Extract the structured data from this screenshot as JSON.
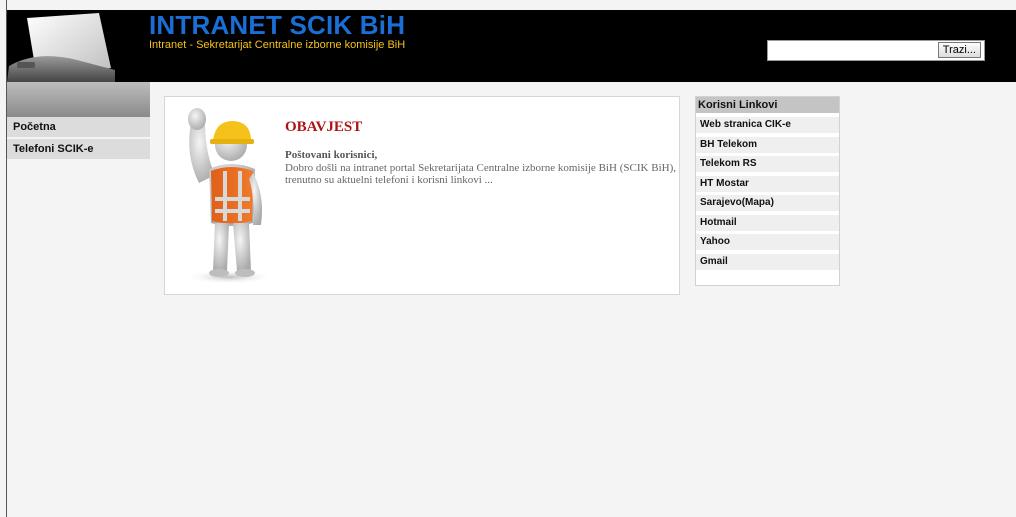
{
  "header": {
    "title": "INTRANET SCIK BiH",
    "subtitle": "Intranet - Sekretarijat Centralne izborne komisije BiH"
  },
  "search": {
    "value": "",
    "placeholder": "",
    "button_label": "Trazi..."
  },
  "sidebar": {
    "items": [
      {
        "label": "Početna"
      },
      {
        "label": "Telefoni SCIK-e"
      }
    ]
  },
  "notice": {
    "title": "OBAVJEST",
    "greeting": "Poštovani korisnici,",
    "body": "Dobro došli na intranet portal Sekretarijata Centralne izborne komisije BiH (SCIK BiH), trenutno su aktuelni telefoni i korisni linkovi ..."
  },
  "useful_links": {
    "title": "Korisni Linkovi",
    "items": [
      {
        "label": "Web stranica CIK-e"
      },
      {
        "label": "BH Telekom"
      },
      {
        "label": "Telekom RS"
      },
      {
        "label": "HT Mostar"
      },
      {
        "label": "Sarajevo(Mapa)"
      },
      {
        "label": "Hotmail"
      },
      {
        "label": "Yahoo"
      },
      {
        "label": "Gmail"
      }
    ]
  },
  "colors": {
    "header_bg": "#000000",
    "title": "#1a6fd6",
    "subtitle": "#f4c21b",
    "notice_title": "#b01212"
  },
  "icons": {
    "logo": "printer-logo-icon",
    "notice_image": "construction-worker-icon"
  }
}
